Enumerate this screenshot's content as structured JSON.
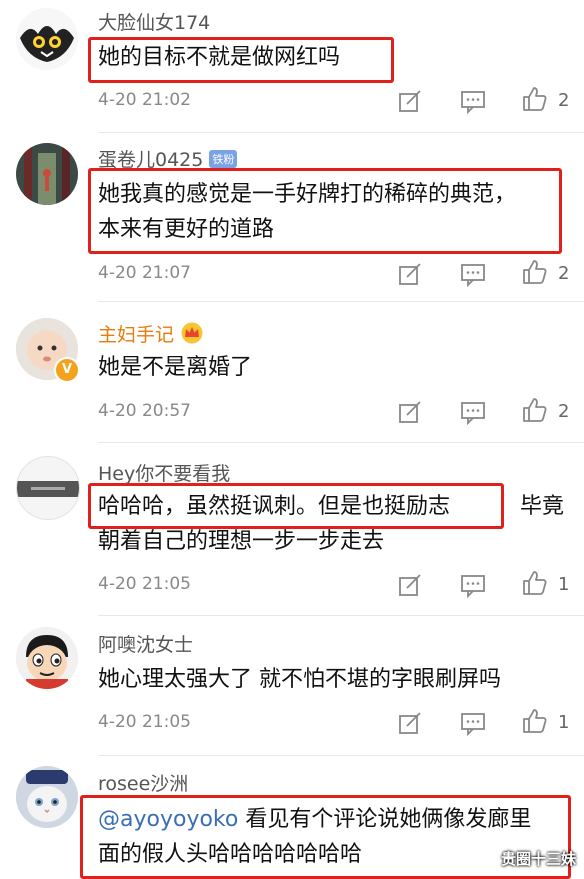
{
  "comments": [
    {
      "username": "大脸仙女174",
      "text_lines": [
        "她的目标不就是做网红吗"
      ],
      "time": "4-20 21:02",
      "likes": "2"
    },
    {
      "username": "蛋卷儿0425",
      "badge": "铁粉",
      "text_lines": [
        "她我真的感觉是一手好牌打的稀碎的典范，",
        "本来有更好的道路"
      ],
      "time": "4-20 21:07",
      "likes": "2"
    },
    {
      "username": "主妇手记",
      "text_lines": [
        "她是不是离婚了"
      ],
      "time": "4-20 20:57",
      "likes": "2"
    },
    {
      "username": "Hey你不要看我",
      "text_lines": [
        "哈哈哈，虽然挺讽刺。但是也挺励志 ",
        "朝着自己的理想一步一步走去"
      ],
      "text_tail": "毕竟",
      "time": "4-20 21:05",
      "likes": "1"
    },
    {
      "username": "阿噢沈女士",
      "text_lines": [
        "她心理太强大了 就不怕不堪的字眼刷屏吗"
      ],
      "time": "4-20 21:05",
      "likes": "1"
    },
    {
      "username": "rosee沙洲",
      "mention": "@ayoyoyoko",
      "text_lines": [
        " 看见有个评论说她俩像发廊里",
        "面的假人头哈哈哈哈哈哈哈"
      ]
    }
  ],
  "watermark": "贵圈十三妹",
  "colors": {
    "highlight": "#e0201a",
    "vip_name": "#e87b0c",
    "mention": "#3a6eb5"
  }
}
